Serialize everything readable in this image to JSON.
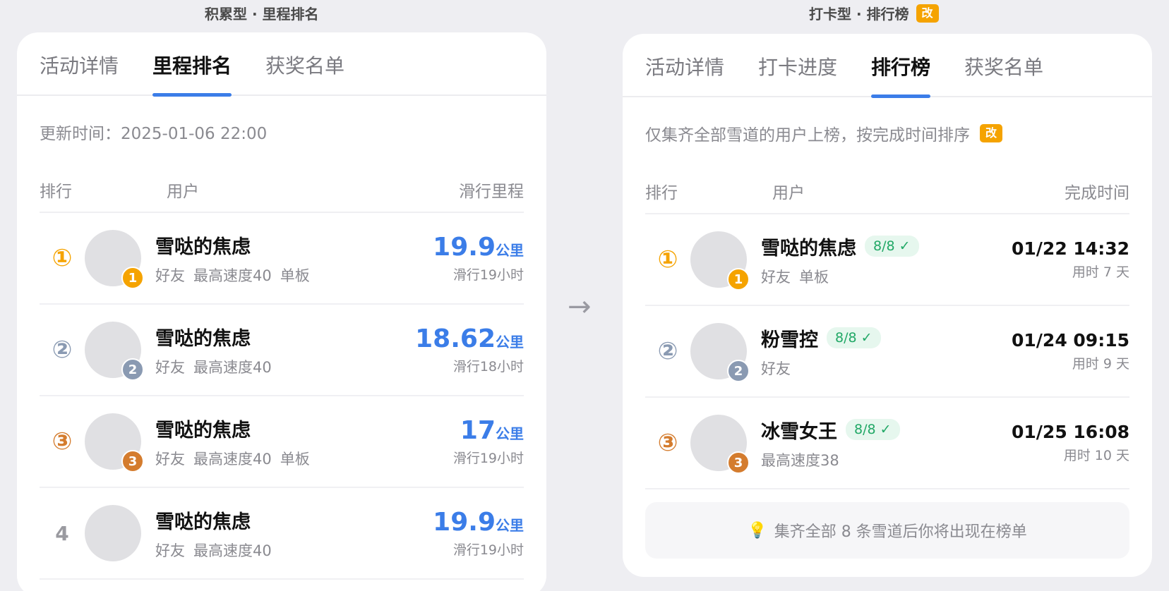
{
  "left": {
    "title": "积累型 · 里程排名",
    "tabs": [
      {
        "label": "活动详情",
        "active": false
      },
      {
        "label": "里程排名",
        "active": true
      },
      {
        "label": "获奖名单",
        "active": false
      }
    ],
    "update_time": "更新时间：2025-01-06 22:00",
    "headers": {
      "rank": "排行",
      "user": "用户",
      "metric": "滑行里程"
    },
    "rows": [
      {
        "rank": "①",
        "dot": "1",
        "name": "雪哒的焦虑",
        "tags": [
          "好友",
          "最高速度40",
          "单板"
        ],
        "value": "19.9",
        "unit": "公里",
        "sub": "滑行19小时"
      },
      {
        "rank": "②",
        "dot": "2",
        "name": "雪哒的焦虑",
        "tags": [
          "好友",
          "最高速度40"
        ],
        "value": "18.62",
        "unit": "公里",
        "sub": "滑行18小时"
      },
      {
        "rank": "③",
        "dot": "3",
        "name": "雪哒的焦虑",
        "tags": [
          "好友",
          "最高速度40",
          "单板"
        ],
        "value": "17",
        "unit": "公里",
        "sub": "滑行19小时"
      },
      {
        "rank": "4",
        "dot": "",
        "name": "雪哒的焦虑",
        "tags": [
          "好友",
          "最高速度40"
        ],
        "value": "19.9",
        "unit": "公里",
        "sub": "滑行19小时"
      }
    ]
  },
  "arrow": "→",
  "right": {
    "title": "打卡型 · 排行榜",
    "title_badge": "改",
    "tabs": [
      {
        "label": "活动详情",
        "active": false
      },
      {
        "label": "打卡进度",
        "active": false
      },
      {
        "label": "排行榜",
        "active": true
      },
      {
        "label": "获奖名单",
        "active": false
      }
    ],
    "note": "仅集齐全部雪道的用户上榜，按完成时间排序",
    "note_badge": "改",
    "headers": {
      "rank": "排行",
      "user": "用户",
      "metric": "完成时间"
    },
    "rows": [
      {
        "rank": "①",
        "dot": "1",
        "name": "雪哒的焦虑",
        "check": "8/8 ✓",
        "tags": [
          "好友",
          "单板"
        ],
        "time": "01/22 14:32",
        "duration": "用时 7 天"
      },
      {
        "rank": "②",
        "dot": "2",
        "name": "粉雪控",
        "check": "8/8 ✓",
        "tags": [
          "好友"
        ],
        "time": "01/24 09:15",
        "duration": "用时 9 天"
      },
      {
        "rank": "③",
        "dot": "3",
        "name": "冰雪女王",
        "check": "8/8 ✓",
        "tags": [
          "最高速度38"
        ],
        "time": "01/25 16:08",
        "duration": "用时 10 天"
      }
    ],
    "tip": "集齐全部 8 条雪道后你将出现在榜单",
    "tip_icon": "lightbulb-icon"
  },
  "colors": {
    "accent": "#3b7de8",
    "gold": "#f5a300",
    "silver": "#8a9ab2",
    "bronze": "#d47c2e",
    "check_green": "#21a866"
  }
}
